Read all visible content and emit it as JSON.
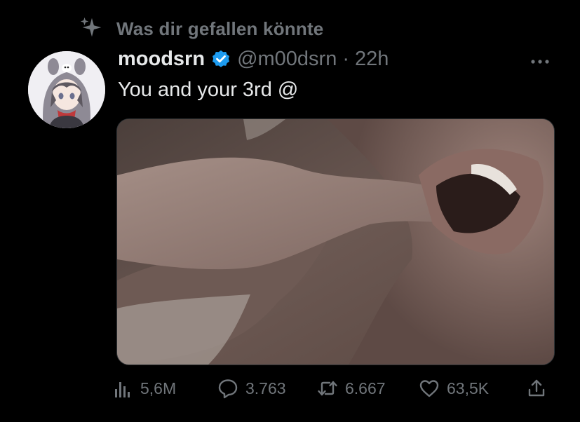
{
  "context": {
    "label": "Was dir gefallen könnte",
    "icon": "sparkle-icon"
  },
  "tweet": {
    "display_name": "moodsrn",
    "verified": true,
    "handle": "@m00dsrn",
    "separator": "·",
    "time": "22h",
    "text": "You and your 3rd @"
  },
  "actions": {
    "views": "5,6M",
    "replies": "3.763",
    "retweets": "6.667",
    "likes": "63,5K"
  },
  "colors": {
    "background": "#000000",
    "primary_text": "#e7e9ea",
    "secondary_text": "#71767b",
    "verified_blue": "#1d9bf0"
  }
}
